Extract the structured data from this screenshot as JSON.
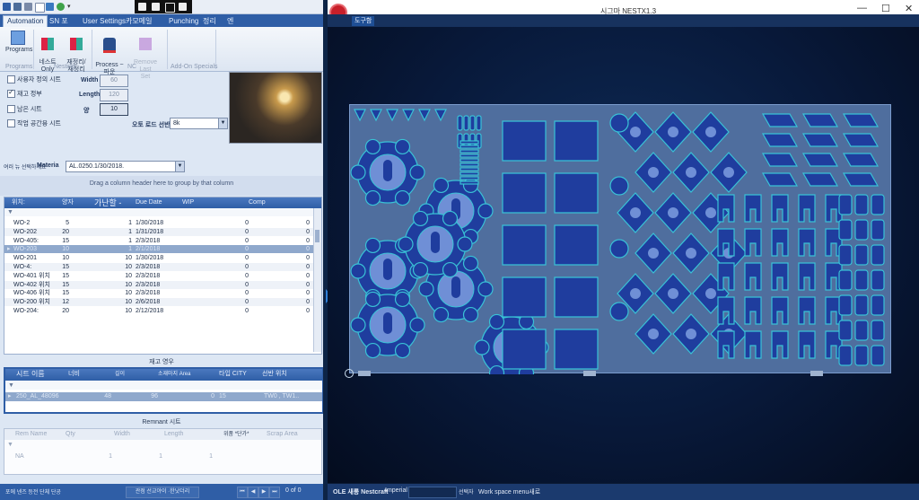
{
  "quick_access": {
    "icons": [
      "save-icon",
      "tools-icon",
      "settings-icon",
      "document-icon",
      "print-icon",
      "refresh-icon",
      "dropdown-icon"
    ]
  },
  "float_toolbar": {
    "icons": [
      "export-icon",
      "screen-icon",
      "window-icon",
      "layout-icon"
    ]
  },
  "ribbon": {
    "tabs": [
      "Automation",
      "SN 포",
      "User Settings",
      "카모메일",
      "Punching",
      "정리",
      "엔"
    ],
    "buttons": {
      "programs": "Programs",
      "nest_only": "네스트\nOnly",
      "regroup": "재정리/\n재정리",
      "process": "Process ~파운\n석",
      "remove_last": "Remove Last\nSet"
    },
    "groups": [
      "Programs",
      "Nesting",
      "NC",
      "Add-On Specials"
    ]
  },
  "options": {
    "user_sheet": "사용자 정의 시트",
    "stock_sheet": "재고 정부",
    "remnant_sheet": "남은 시트",
    "work_space_sheet": "작업 공간용 시트",
    "width_label": "Width",
    "width_value": "60",
    "length_label": "Length",
    "length_value": "120",
    "qty_label": "양",
    "qty_value": "10",
    "auto_load_label": "오토 로드 선반",
    "auto_load_value": "8k"
  },
  "material": {
    "label_small": "여러 뉴 선택하세요",
    "label": "Materia",
    "value": "AL.0250.1/30/2018."
  },
  "group_hint": "Drag a column header here to group by that column",
  "work_orders": {
    "headers": [
      "위치:",
      "양자",
      "가난할 -",
      "Due Date",
      "WIP",
      "Comp"
    ],
    "rows": [
      {
        "name": "WO-2",
        "qty": "5",
        "due_qty": "1",
        "date": "1/30/2018",
        "wip": "0",
        "comp": "0"
      },
      {
        "name": "WO-202",
        "qty": "20",
        "due_qty": "1",
        "date": "1/31/2018",
        "wip": "0",
        "comp": "0"
      },
      {
        "name": "WO-405:",
        "qty": "15",
        "due_qty": "1",
        "date": "2/3/2018",
        "wip": "0",
        "comp": "0"
      },
      {
        "name": "WO-203",
        "qty": "10",
        "due_qty": "1",
        "date": "2/1/2018",
        "wip": "0",
        "comp": "0"
      },
      {
        "name": "WO-201",
        "qty": "10",
        "due_qty": "10",
        "date": "1/30/2018",
        "wip": "0",
        "comp": "0"
      },
      {
        "name": "WO-4:",
        "qty": "15",
        "due_qty": "10",
        "date": "2/3/2018",
        "wip": "0",
        "comp": "0"
      },
      {
        "name": "WO-401 위치",
        "qty": "15",
        "due_qty": "10",
        "date": "2/3/2018",
        "wip": "0",
        "comp": "0"
      },
      {
        "name": "WO-402 위치",
        "qty": "15",
        "due_qty": "10",
        "date": "2/3/2018",
        "wip": "0",
        "comp": "0"
      },
      {
        "name": "WO-406 위치",
        "qty": "15",
        "due_qty": "10",
        "date": "2/3/2018",
        "wip": "0",
        "comp": "0"
      },
      {
        "name": "WO-200 위치",
        "qty": "12",
        "due_qty": "10",
        "date": "2/6/2018",
        "wip": "0",
        "comp": "0"
      },
      {
        "name": "WO-204:",
        "qty": "20",
        "due_qty": "10",
        "date": "2/12/2018",
        "wip": "0",
        "comp": "0"
      }
    ]
  },
  "stock_band": "재고 영우",
  "sheets": {
    "headers": [
      "시트 이름",
      "너비",
      "길이",
      "소재마지 Area",
      "타입  CITY",
      "선반 위치"
    ],
    "rows": [
      {
        "name": "250_AL_48096",
        "width": "48",
        "length": "96",
        "area": "0",
        "qty": "15",
        "location": "TW0 , TW1.."
      }
    ]
  },
  "remnant": {
    "title": "Remnant  시트",
    "headers": [
      "Rem Name",
      "Qty",
      "Width",
      "Length",
      "위품 *단가*",
      "Scrap Area"
    ],
    "rows": [
      {
        "name": "NA",
        "qty": "1",
        "width": "1",
        "length": "1"
      }
    ]
  },
  "status_left": {
    "left": "포에 넨즈 등전 단체 단공",
    "mid": "관점 선교야이 ·한낫더리",
    "page": "0 of 0"
  },
  "app": {
    "title": "시그마 NESTX1.3",
    "tool_tab": "도구함",
    "controls": [
      "—",
      "☐",
      "✕"
    ]
  },
  "status_right": {
    "brand": "OLE 새롱 Nestcraft",
    "units": "Imperial",
    "hint_label": "선택자",
    "hint": "Work space menu새로"
  },
  "colors": {
    "accent": "#2f5ea6",
    "part_fill": "#1f3d9e",
    "part_edge": "#39c2d6",
    "hole": "#6f8fd6",
    "sheet": "#4f6e9e"
  }
}
